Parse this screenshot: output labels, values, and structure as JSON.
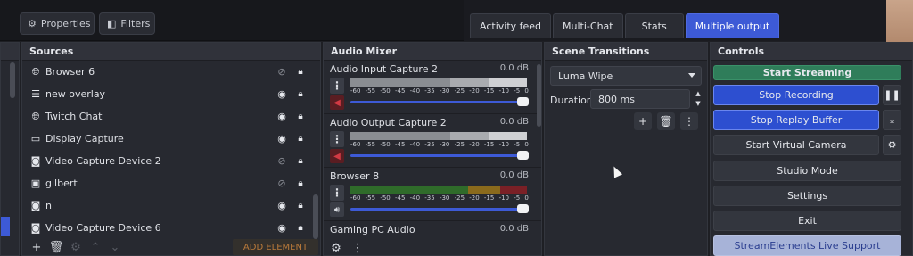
{
  "toolbar": {
    "properties_label": "Properties",
    "filters_label": "Filters"
  },
  "tabs": [
    {
      "label": "Activity feed",
      "active": false
    },
    {
      "label": "Multi-Chat",
      "active": false
    },
    {
      "label": "Stats",
      "active": false
    },
    {
      "label": "Multiple output",
      "active": true
    }
  ],
  "sources": {
    "title": "Sources",
    "items": [
      {
        "label": "Browser 6",
        "icon": "globe-icon",
        "visible": false
      },
      {
        "label": "new overlay",
        "icon": "list-icon",
        "visible": true
      },
      {
        "label": "Twitch Chat",
        "icon": "globe-icon",
        "visible": true
      },
      {
        "label": "Display Capture",
        "icon": "monitor-icon",
        "visible": true
      },
      {
        "label": "Video Capture Device 2",
        "icon": "camera-icon",
        "visible": false
      },
      {
        "label": "gilbert",
        "icon": "image-icon",
        "visible": false
      },
      {
        "label": "n",
        "icon": "camera-icon",
        "visible": true
      },
      {
        "label": "Video Capture Device 6",
        "icon": "camera-icon",
        "visible": true
      }
    ],
    "add_element_label": "ADD ELEMENT"
  },
  "mixer": {
    "title": "Audio Mixer",
    "scale": [
      "-60",
      "-55",
      "-50",
      "-45",
      "-40",
      "-35",
      "-30",
      "-25",
      "-20",
      "-15",
      "-10",
      "-5",
      "0"
    ],
    "channels": [
      {
        "name": "Audio Input Capture 2",
        "db": "0.0 dB",
        "muted": true
      },
      {
        "name": "Audio Output Capture 2",
        "db": "0.0 dB",
        "muted": true
      },
      {
        "name": "Browser 8",
        "db": "0.0 dB",
        "muted": false
      },
      {
        "name": "Gaming PC Audio",
        "db": "0.0 dB",
        "muted": false
      }
    ]
  },
  "transitions": {
    "title": "Scene Transitions",
    "selected": "Luma Wipe",
    "duration_label": "Duration",
    "duration_value": "800 ms"
  },
  "controls": {
    "title": "Controls",
    "start_streaming": "Start Streaming",
    "stop_recording": "Stop Recording",
    "stop_replay_buffer": "Stop Replay Buffer",
    "start_virtual_camera": "Start Virtual Camera",
    "studio_mode": "Studio Mode",
    "settings": "Settings",
    "exit": "Exit",
    "support": "StreamElements Live Support"
  },
  "colors": {
    "accent": "#3d5ad6",
    "streaming": "#2f7d5a",
    "add_element": "#b8793a"
  }
}
